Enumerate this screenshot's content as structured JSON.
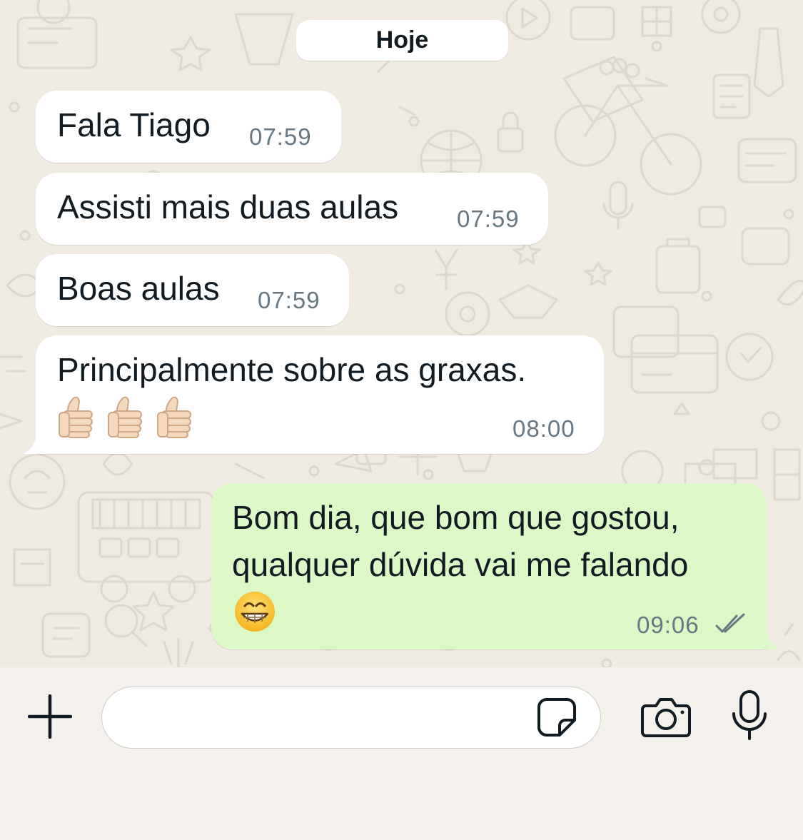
{
  "chat": {
    "date_label": "Hoje",
    "messages": [
      {
        "direction": "incoming",
        "text": "Fala Tiago",
        "time": "07:59"
      },
      {
        "direction": "incoming",
        "text": "Assisti mais duas aulas",
        "time": "07:59"
      },
      {
        "direction": "incoming",
        "text": "Boas aulas",
        "time": "07:59"
      },
      {
        "direction": "incoming",
        "text": "Principalmente sobre as graxas.",
        "emojis": [
          "thumbs-up",
          "thumbs-up",
          "thumbs-up"
        ],
        "time": "08:00"
      },
      {
        "direction": "outgoing",
        "lines": [
          "Bom dia, que bom que gostou,",
          "qualquer dúvida vai me falando"
        ],
        "emojis": [
          "grinning-face"
        ],
        "time": "09:06",
        "status": "read"
      }
    ]
  },
  "input_bar": {
    "message_value": "",
    "message_placeholder": "",
    "icons": [
      "plus-icon",
      "sticker-icon",
      "camera-icon",
      "microphone-icon"
    ]
  },
  "colors": {
    "background": "#efeae2",
    "incoming_bubble": "#ffffff",
    "outgoing_bubble": "#dcf8c6",
    "timestamp": "#667781",
    "text": "#111b21"
  }
}
